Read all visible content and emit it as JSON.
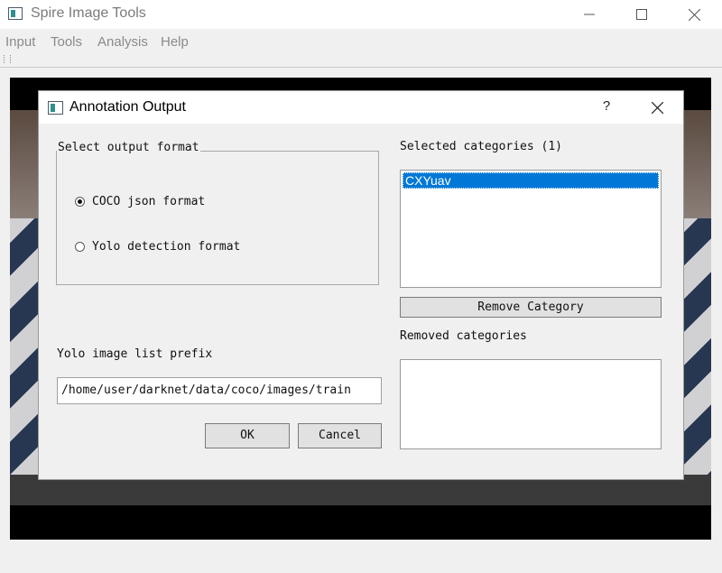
{
  "app": {
    "title": "Spire Image Tools",
    "menu": [
      "Input",
      "Tools",
      "Analysis",
      "Help"
    ]
  },
  "dialog": {
    "title": "Annotation Output",
    "help_label": "?",
    "output_format": {
      "title": "Select output format",
      "options": [
        {
          "label": "COCO json format",
          "selected": true
        },
        {
          "label": "Yolo detection format",
          "selected": false
        }
      ]
    },
    "prefix": {
      "label": "Yolo image list prefix",
      "value": "/home/user/darknet/data/coco/images/train"
    },
    "buttons": {
      "ok": "OK",
      "cancel": "Cancel",
      "remove": "Remove Category"
    },
    "selected_categories": {
      "label": "Selected categories (1)",
      "items": [
        "CXYuav"
      ]
    },
    "removed_categories": {
      "label": "Removed categories",
      "items": []
    }
  },
  "colors": {
    "selection": "#0078d7",
    "window_bg": "#f0f0f0"
  }
}
